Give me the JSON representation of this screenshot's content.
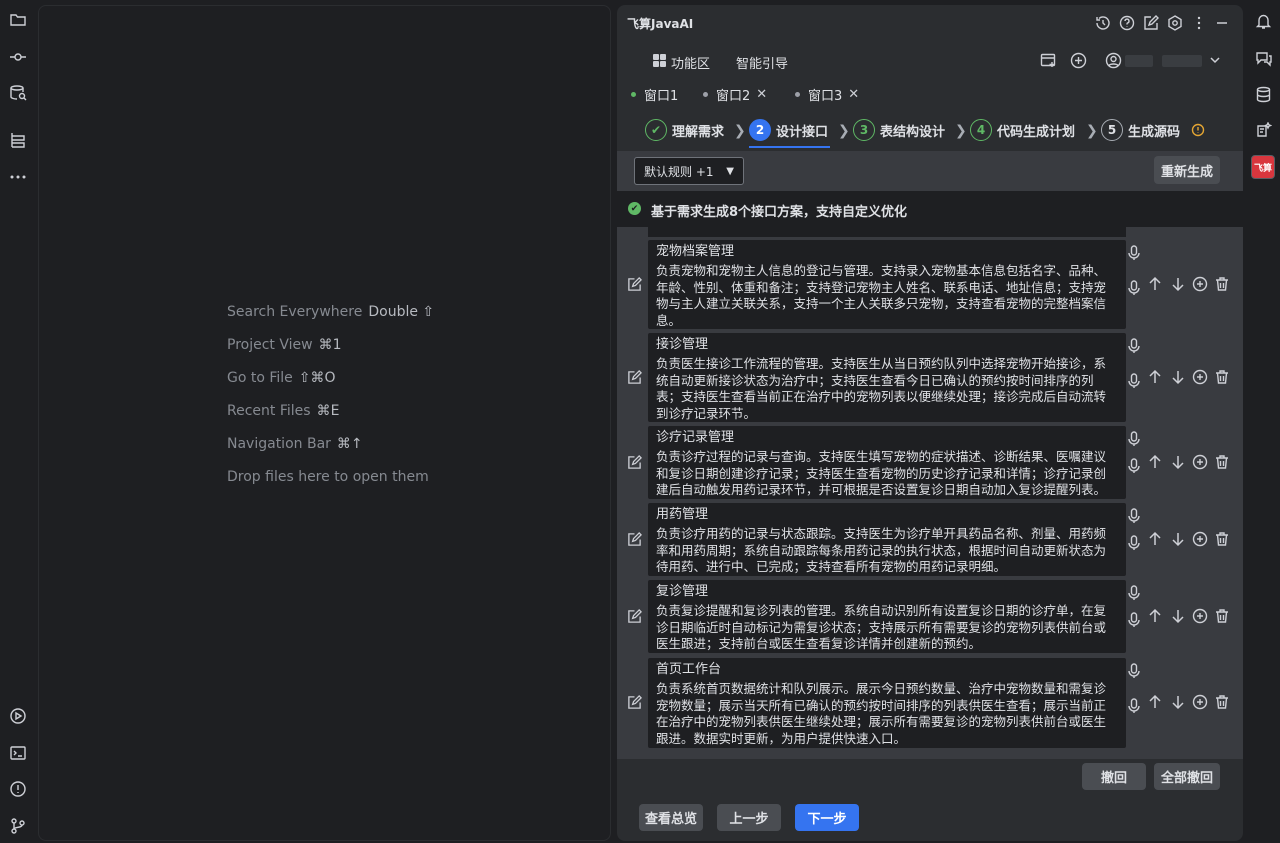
{
  "editor": {
    "hints": [
      {
        "label": "Search Everywhere",
        "shortcut": "Double ⇧"
      },
      {
        "label": "Project View",
        "shortcut": "⌘1"
      },
      {
        "label": "Go to File",
        "shortcut": "⇧⌘O"
      },
      {
        "label": "Recent Files",
        "shortcut": "⌘E"
      },
      {
        "label": "Navigation Bar",
        "shortcut": "⌘↑"
      },
      {
        "label": "Drop files here to open them",
        "shortcut": ""
      }
    ]
  },
  "panel": {
    "title": "飞算JavaAI",
    "nav": {
      "features_label": "功能区",
      "guide_label": "智能引导"
    },
    "tabs": [
      {
        "label": "窗口1",
        "active": true
      },
      {
        "label": "窗口2",
        "active": false
      },
      {
        "label": "窗口3",
        "active": false
      }
    ],
    "steps": [
      {
        "num": "✔",
        "label": "理解需求",
        "state": "done"
      },
      {
        "num": "2",
        "label": "设计接口",
        "state": "active"
      },
      {
        "num": "3",
        "label": "表结构设计",
        "state": "pending-green"
      },
      {
        "num": "4",
        "label": "代码生成计划",
        "state": "pending-green"
      },
      {
        "num": "5",
        "label": "生成源码",
        "state": "pending"
      }
    ],
    "rule_select": "默认规则 +1",
    "regenerate_label": "重新生成",
    "status_text": "基于需求生成8个接口方案，支持自定义优化",
    "cards": [
      {
        "title": "宠物档案管理",
        "desc": "负责宠物和宠物主人信息的登记与管理。支持录入宠物基本信息包括名字、品种、年龄、性别、体重和备注；支持登记宠物主人姓名、联系电话、地址信息；支持宠物与主人建立关联关系，支持一个主人关联多只宠物，支持查看宠物的完整档案信息。"
      },
      {
        "title": "接诊管理",
        "desc": "负责医生接诊工作流程的管理。支持医生从当日预约队列中选择宠物开始接诊，系统自动更新接诊状态为治疗中；支持医生查看今日已确认的预约按时间排序的列表；支持医生查看当前正在治疗中的宠物列表以便继续处理；接诊完成后自动流转到诊疗记录环节。"
      },
      {
        "title": "诊疗记录管理",
        "desc": "负责诊疗过程的记录与查询。支持医生填写宠物的症状描述、诊断结果、医嘱建议和复诊日期创建诊疗记录；支持医生查看宠物的历史诊疗记录和详情；诊疗记录创建后自动触发用药记录环节，并可根据是否设置复诊日期自动加入复诊提醒列表。"
      },
      {
        "title": "用药管理",
        "desc": "负责诊疗用药的记录与状态跟踪。支持医生为诊疗单开具药品名称、剂量、用药频率和用药周期；系统自动跟踪每条用药记录的执行状态，根据时间自动更新状态为待用药、进行中、已完成；支持查看所有宠物的用药记录明细。"
      },
      {
        "title": "复诊管理",
        "desc": "负责复诊提醒和复诊列表的管理。系统自动识别所有设置复诊日期的诊疗单，在复诊日期临近时自动标记为需复诊状态；支持展示所有需要复诊的宠物列表供前台或医生跟进；支持前台或医生查看复诊详情并创建新的预约。"
      },
      {
        "title": "首页工作台",
        "desc": "负责系统首页数据统计和队列展示。展示今日预约数量、治疗中宠物数量和需复诊宠物数量；展示当天所有已确认的预约按时间排序的列表供医生查看；展示当前正在治疗中的宠物列表供医生继续处理；展示所有需要复诊的宠物列表供前台或医生跟进。数据实时更新，为用户提供快速入口。"
      }
    ],
    "undo_label": "撤回",
    "undo_all_label": "全部撤回",
    "overview_label": "查看总览",
    "prev_label": "上一步",
    "next_label": "下一步"
  },
  "colors": {
    "accent": "#3574f0",
    "success": "#5fb865",
    "warning": "#e5a633",
    "brand_red": "#d9363e"
  }
}
